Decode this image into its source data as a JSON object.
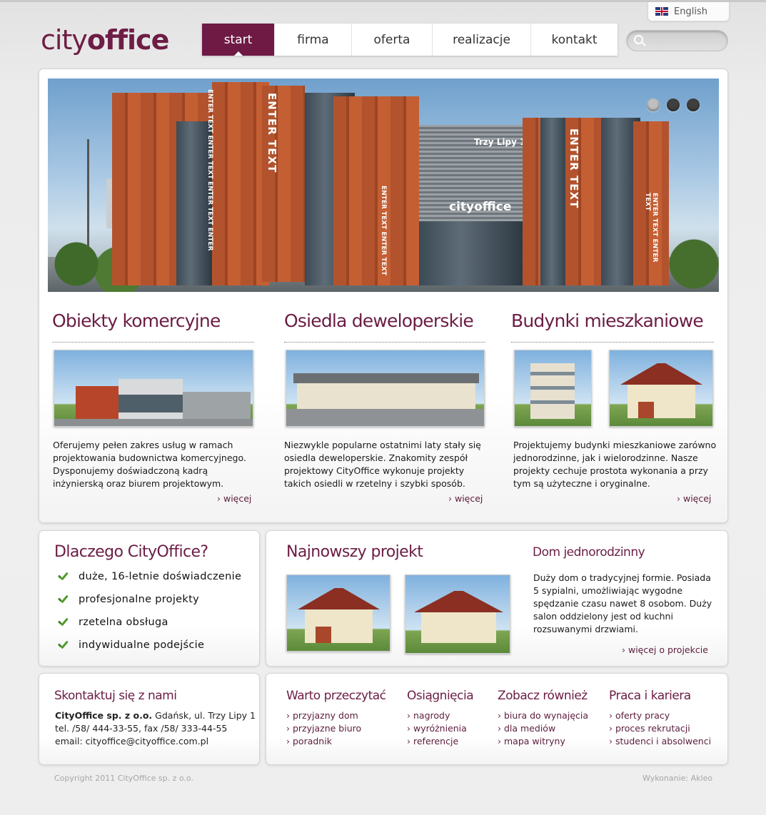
{
  "language": {
    "label": "English"
  },
  "logo": {
    "part1": "city",
    "part2": "office"
  },
  "nav": {
    "items": [
      {
        "label": "start",
        "active": true
      },
      {
        "label": "firma",
        "active": false
      },
      {
        "label": "oferta",
        "active": false
      },
      {
        "label": "realizacje",
        "active": false
      },
      {
        "label": "kontakt",
        "active": false
      }
    ]
  },
  "search": {
    "placeholder": ""
  },
  "hero": {
    "sign_trzy_lipy": "Trzy Lipy 1",
    "sign_brand": "cityoffice",
    "vertical_text_1": "ENTER TEXT",
    "vertical_text_2": "ENTER TEXT",
    "vertical_small_1": "ENTER TEXT ENTER TEXT ENTER TEXT ENTER",
    "vertical_small_2": "ENTER TEXT ENTER TEXT",
    "vertical_small_3": "ENTER TEXT ENTER TEXT",
    "slides": 3,
    "active_slide": 1
  },
  "columns": [
    {
      "title": "Obiekty komercyjne",
      "text": "Oferujemy pełen zakres usług w ramach projektowania budownictwa komercyjnego. Dysponujemy doświadczoną kadrą inżynierską oraz biurem projektowym.",
      "more": "więcej"
    },
    {
      "title": "Osiedla deweloperskie",
      "text": "Niezwykle popularne ostatnimi laty stały się osiedla deweloperskie. Znakomity zespół projektowy CityOffice wykonuje projekty takich osiedli w rzetelny i szybki sposób.",
      "more": "więcej"
    },
    {
      "title": "Budynki mieszkaniowe",
      "text": "Projektujemy budynki mieszkaniowe zarówno jednorodzinne, jak i wielorodzinne. Nasze projekty cechuje prostota wykonania a przy tym są użyteczne i oryginalne.",
      "more": "więcej"
    }
  ],
  "why": {
    "title": "Dlaczego CityOffice?",
    "items": [
      "duże, 16-letnie doświadczenie",
      "profesjonalne projekty",
      "rzetelna obsługa",
      "indywidualne podejście"
    ]
  },
  "latest": {
    "title": "Najnowszy projekt",
    "subtitle": "Dom jednorodzinny",
    "text": "Duży dom o tradycyjnej formie. Posiada 5 sypialni, umożliwiając wygodne spędzanie czasu nawet 8 osobom. Duży salon oddzielony jest od kuchni rozsuwanymi drzwiami.",
    "more": "więcej o projekcie"
  },
  "contact": {
    "title": "Skontaktuj się z nami",
    "company": "CityOffice sp. z o.o.",
    "address": "Gdańsk, ul. Trzy Lipy 1",
    "phones": "tel. /58/ 444-33-55, fax /58/ 333-44-55",
    "email": "email: cityoffice@cityoffice.com.pl"
  },
  "links": [
    {
      "title": "Warto przeczytać",
      "items": [
        "przyjazny dom",
        "przyjazne biuro",
        "poradnik"
      ]
    },
    {
      "title": "Osiągnięcia",
      "items": [
        "nagrody",
        "wyróżnienia",
        "referencje"
      ]
    },
    {
      "title": "Zobacz również",
      "items": [
        "biura do wynajęcia",
        "dla mediów",
        "mapa witryny"
      ]
    },
    {
      "title": "Praca i kariera",
      "items": [
        "oferty pracy",
        "proces rekrutacji",
        "studenci i absolwenci"
      ]
    }
  ],
  "footer": {
    "copyright": "Copyright 2011 CityOffice sp. z o.o.",
    "credit": "Wykonanie: Akleo"
  },
  "colors": {
    "brand": "#6e1a45",
    "text": "#222222",
    "link": "#5c1c3c"
  }
}
